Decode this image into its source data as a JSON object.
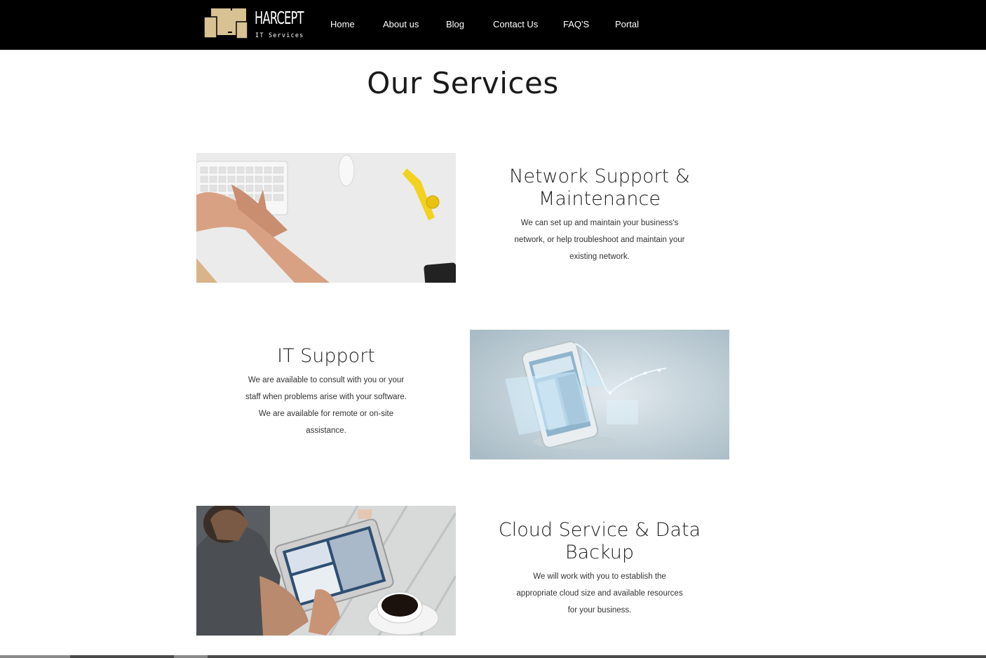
{
  "brand": {
    "name": "HARCEPT",
    "tagline": "IT Services",
    "accent_color": "#d8c193"
  },
  "nav": {
    "items": [
      {
        "label": "Home"
      },
      {
        "label": "About us"
      },
      {
        "label": "Blog"
      },
      {
        "label": "Contact Us"
      },
      {
        "label": "FAQ'S"
      },
      {
        "label": "Portal"
      }
    ]
  },
  "main": {
    "title": "Our Services",
    "services": [
      {
        "title": "Network Support & Maintenance",
        "description": "We can set up and maintain your business's network, or help troubleshoot and maintain your existing network.",
        "image": "keyboard-typing-photo"
      },
      {
        "title": "IT Support",
        "description": "We are available to consult with you or your staff when problems arise with your software. We are available for remote or on-site assistance.",
        "image": "smartphone-hologram-charts-photo"
      },
      {
        "title": "Cloud Service & Data Backup",
        "description": "We will work with you to establish the appropriate cloud size and available resources for your business.",
        "image": "man-using-tablet-coffee-photo"
      }
    ]
  }
}
